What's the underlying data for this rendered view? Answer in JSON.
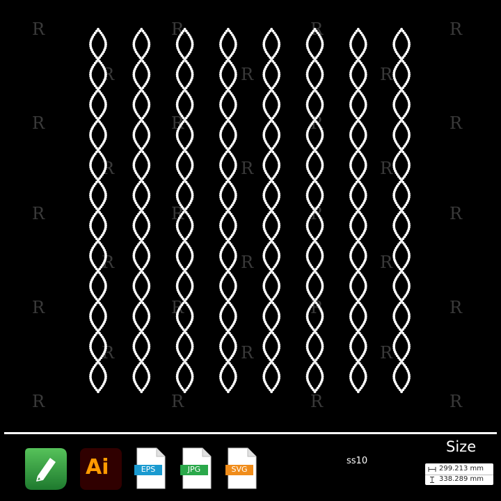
{
  "design": {
    "watermark_glyph": "R",
    "stone_color": "#ffffff",
    "background": "#000000",
    "columns": 8,
    "loops_per_column": 12
  },
  "footer": {
    "apps": [
      {
        "name": "coreldraw-icon",
        "color": "#2e8b3a"
      },
      {
        "name": "illustrator-icon",
        "label": "Ai",
        "color": "#300000",
        "accent": "#ff9a00"
      }
    ],
    "files": [
      {
        "name": "eps-file-icon",
        "label": "EPS",
        "color": "#1a9ad0"
      },
      {
        "name": "jpg-file-icon",
        "label": "JPG",
        "color": "#2aa84a"
      },
      {
        "name": "svg-file-icon",
        "label": "SVG",
        "color": "#f08c1a"
      }
    ],
    "stone_size": "ss10",
    "size_title": "Size",
    "width": "299.213 mm",
    "height": "338.289 mm"
  }
}
